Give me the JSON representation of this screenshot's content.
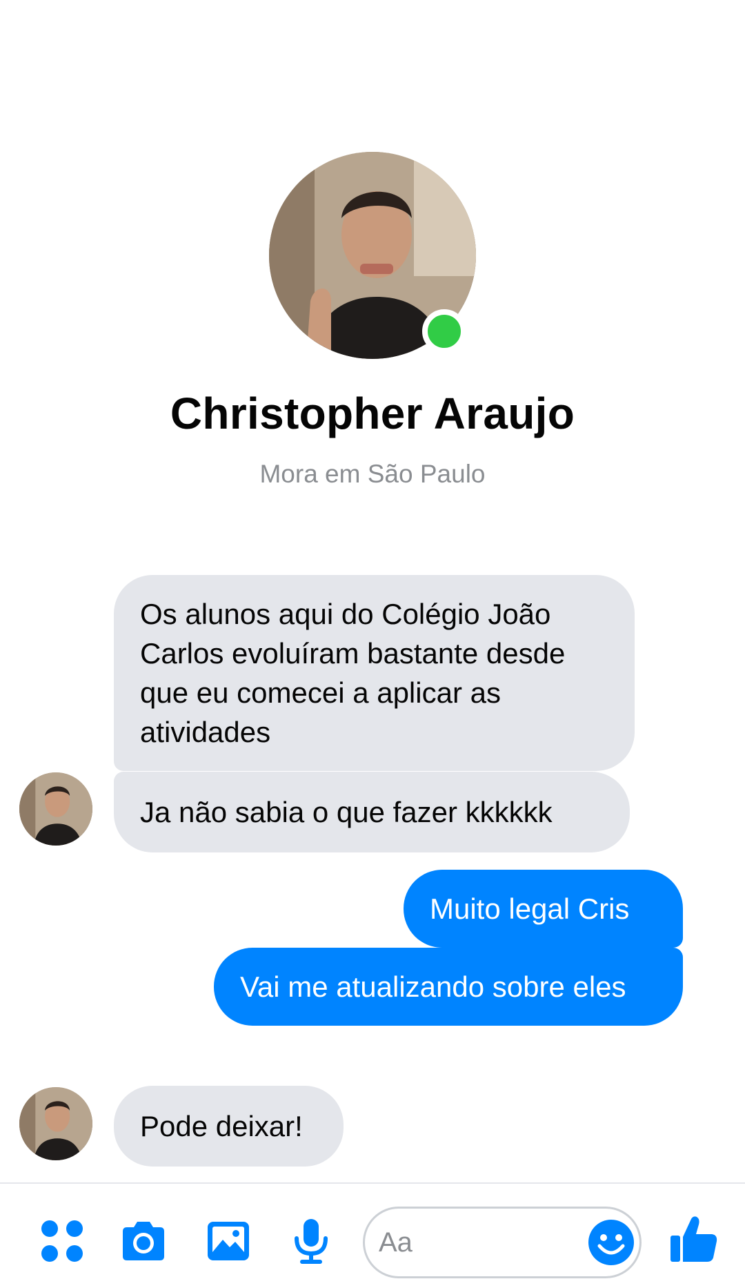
{
  "header": {
    "name": "Christopher Araujo",
    "subtitle": "Mora em São Paulo",
    "online": true
  },
  "messages": [
    {
      "side": "incoming",
      "text": "Os alunos aqui do Colégio João Carlos evoluíram bastante desde que eu comecei a aplicar as atividades"
    },
    {
      "side": "incoming",
      "text": "Ja não sabia o que fazer kkkkkk"
    },
    {
      "side": "outgoing",
      "text": "Muito legal Cris"
    },
    {
      "side": "outgoing",
      "text": "Vai me atualizando sobre eles"
    },
    {
      "side": "incoming",
      "text": "Pode deixar!"
    }
  ],
  "composer": {
    "placeholder": "Aa",
    "icons": [
      "menu-icon",
      "camera-icon",
      "gallery-icon",
      "microphone-icon",
      "emoji-icon",
      "like-icon"
    ]
  },
  "colors": {
    "accent": "#0084ff",
    "incoming_bubble": "#e4e6eb",
    "online": "#31cc46"
  }
}
